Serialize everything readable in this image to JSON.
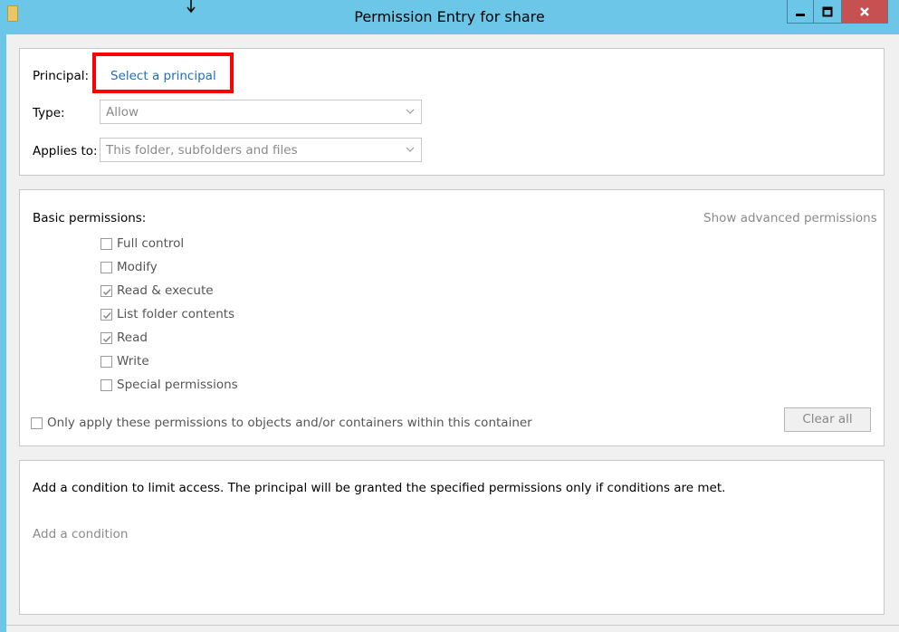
{
  "window": {
    "title": "Permission Entry for share"
  },
  "principal": {
    "label": "Principal:",
    "link": "Select a principal"
  },
  "type": {
    "label": "Type:",
    "value": "Allow"
  },
  "applies": {
    "label": "Applies to:",
    "value": "This folder, subfolders and files"
  },
  "basic": {
    "label": "Basic permissions:",
    "advanced_link": "Show advanced permissions",
    "items": [
      {
        "label": "Full control",
        "checked": false
      },
      {
        "label": "Modify",
        "checked": false
      },
      {
        "label": "Read & execute",
        "checked": true
      },
      {
        "label": "List folder contents",
        "checked": true
      },
      {
        "label": "Read",
        "checked": true
      },
      {
        "label": "Write",
        "checked": false
      },
      {
        "label": "Special permissions",
        "checked": false
      }
    ],
    "only_apply": {
      "label": "Only apply these permissions to objects and/or containers within this container",
      "checked": false
    },
    "clear_all": "Clear all"
  },
  "condition": {
    "text": "Add a condition to limit access. The principal will be granted the specified permissions only if conditions are met.",
    "link": "Add a condition"
  },
  "colors": {
    "titlebar": "#6bc6e8",
    "close": "#c75050",
    "link": "#1a6fc9",
    "highlight": "#ff0000"
  }
}
